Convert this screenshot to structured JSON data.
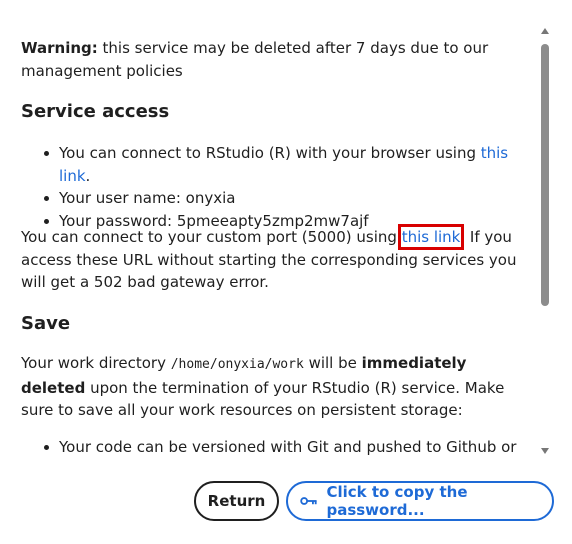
{
  "warning": {
    "label": "Warning:",
    "text": " this service may be deleted after 7 days due to our management policies"
  },
  "access": {
    "heading": "Service access",
    "items": [
      {
        "prefix": "You can connect to RStudio (R) with your browser using ",
        "link": "this link",
        "suffix": "."
      },
      {
        "text": "Your user name: onyxia"
      },
      {
        "text": "Your password: 5pmeeapty5zmp2mw7ajf"
      }
    ],
    "port_prefix": "You can connect to your custom port (5000) using ",
    "port_link": "this link",
    "port_suffix": ". If you access these URL without starting the corresponding services you will get a 502 bad gateway error."
  },
  "save": {
    "heading": "Save",
    "p1": "Your work directory ",
    "path": "/home/onyxia/work",
    "p2": " will be ",
    "emph": "immediately deleted",
    "p3": " upon the termination of your RStudio (R) service. Make sure to save all your work resources on persistent storage:",
    "items": [
      {
        "text": "Your code can be versioned with Git and pushed to Github or"
      }
    ]
  },
  "buttons": {
    "return_label": "Return",
    "copy_label": "Click to copy the password..."
  },
  "colors": {
    "link": "#1e6ad6",
    "highlight": "#d80000"
  },
  "icons": {
    "copy_button_icon": "key-icon",
    "scroll_up": "chevron-up-icon",
    "scroll_down": "chevron-down-icon"
  }
}
